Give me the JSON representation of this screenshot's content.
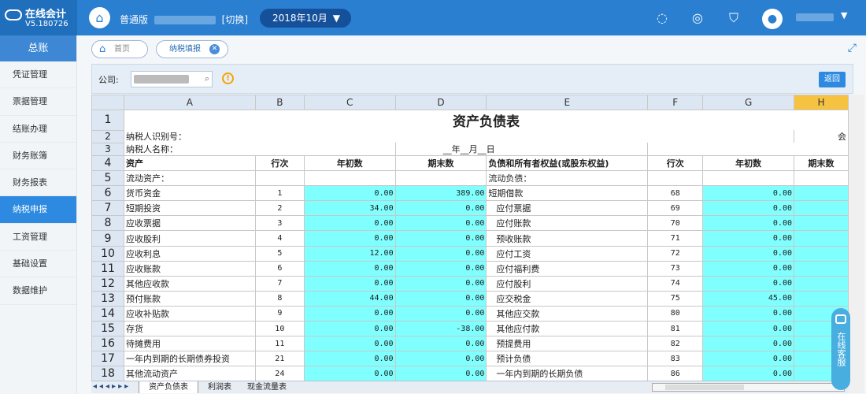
{
  "app": {
    "name": "在线会计",
    "version": "V5.180726"
  },
  "topbar": {
    "edition_label": "普通版",
    "switch_label": "[切换]",
    "period": "2018年10月"
  },
  "sidebar": {
    "header": "总账",
    "items": [
      {
        "label": "凭证管理"
      },
      {
        "label": "票据管理"
      },
      {
        "label": "结账办理"
      },
      {
        "label": "财务账簿"
      },
      {
        "label": "财务报表"
      },
      {
        "label": "纳税申报"
      },
      {
        "label": "工资管理"
      },
      {
        "label": "基础设置"
      },
      {
        "label": "数据维护"
      }
    ]
  },
  "tabs": {
    "home": "首页",
    "current": "纳税填报"
  },
  "filter": {
    "company_label": "公司:",
    "back_button": "返回"
  },
  "sheet": {
    "col_headers": [
      "A",
      "B",
      "C",
      "D",
      "E",
      "F",
      "G",
      "H"
    ],
    "title": "资产负债表",
    "taxpayer_id_label": "纳税人识别号：",
    "taxpayer_name_label": "纳税人名称：",
    "date_line": "__年__月__日",
    "right_fragment": "会",
    "header": {
      "asset": "资产",
      "line": "行次",
      "begin": "年初数",
      "end": "期末数",
      "liab": "负债和所有者权益(或股东权益)",
      "line2": "行次",
      "begin2": "年初数",
      "end2": "期末数"
    },
    "section_row": {
      "left": "流动资产：",
      "right": "流动负债："
    },
    "rows": [
      {
        "n": "6",
        "a": "货币资金",
        "b": "1",
        "c": "0.00",
        "d": "389.00",
        "e": "短期借款",
        "f": "68",
        "g": "0.00"
      },
      {
        "n": "7",
        "a": "短期投资",
        "b": "2",
        "c": "34.00",
        "d": "0.00",
        "e": "应付票据",
        "f": "69",
        "g": "0.00"
      },
      {
        "n": "8",
        "a": "应收票据",
        "b": "3",
        "c": "0.00",
        "d": "0.00",
        "e": "应付账款",
        "f": "70",
        "g": "0.00"
      },
      {
        "n": "9",
        "a": "应收股利",
        "b": "4",
        "c": "0.00",
        "d": "0.00",
        "e": "预收账款",
        "f": "71",
        "g": "0.00"
      },
      {
        "n": "10",
        "a": "应收利息",
        "b": "5",
        "c": "12.00",
        "d": "0.00",
        "e": "应付工资",
        "f": "72",
        "g": "0.00"
      },
      {
        "n": "11",
        "a": "应收账款",
        "b": "6",
        "c": "0.00",
        "d": "0.00",
        "e": "应付福利费",
        "f": "73",
        "g": "0.00"
      },
      {
        "n": "12",
        "a": "其他应收款",
        "b": "7",
        "c": "0.00",
        "d": "0.00",
        "e": "应付股利",
        "f": "74",
        "g": "0.00"
      },
      {
        "n": "13",
        "a": "预付账款",
        "b": "8",
        "c": "44.00",
        "d": "0.00",
        "e": "应交税金",
        "f": "75",
        "g": "45.00"
      },
      {
        "n": "14",
        "a": "应收补贴款",
        "b": "9",
        "c": "0.00",
        "d": "0.00",
        "e": "其他应交款",
        "f": "80",
        "g": "0.00"
      },
      {
        "n": "15",
        "a": "存货",
        "b": "10",
        "c": "0.00",
        "d": "-38.00",
        "e": "其他应付款",
        "f": "81",
        "g": "0.00"
      },
      {
        "n": "16",
        "a": "待摊费用",
        "b": "11",
        "c": "0.00",
        "d": "0.00",
        "e": "预提费用",
        "f": "82",
        "g": "0.00"
      },
      {
        "n": "17",
        "a": "一年内到期的长期债券投资",
        "b": "21",
        "c": "0.00",
        "d": "0.00",
        "e": "预计负债",
        "f": "83",
        "g": "0.00"
      },
      {
        "n": "18",
        "a": "其他流动资产",
        "b": "24",
        "c": "0.00",
        "d": "0.00",
        "e": "一年内到期的长期负债",
        "f": "86",
        "g": "0.00"
      }
    ]
  },
  "sheet_tabs": [
    "资产负债表",
    "利润表",
    "现金流量表"
  ],
  "service": {
    "label": "在线客服"
  }
}
